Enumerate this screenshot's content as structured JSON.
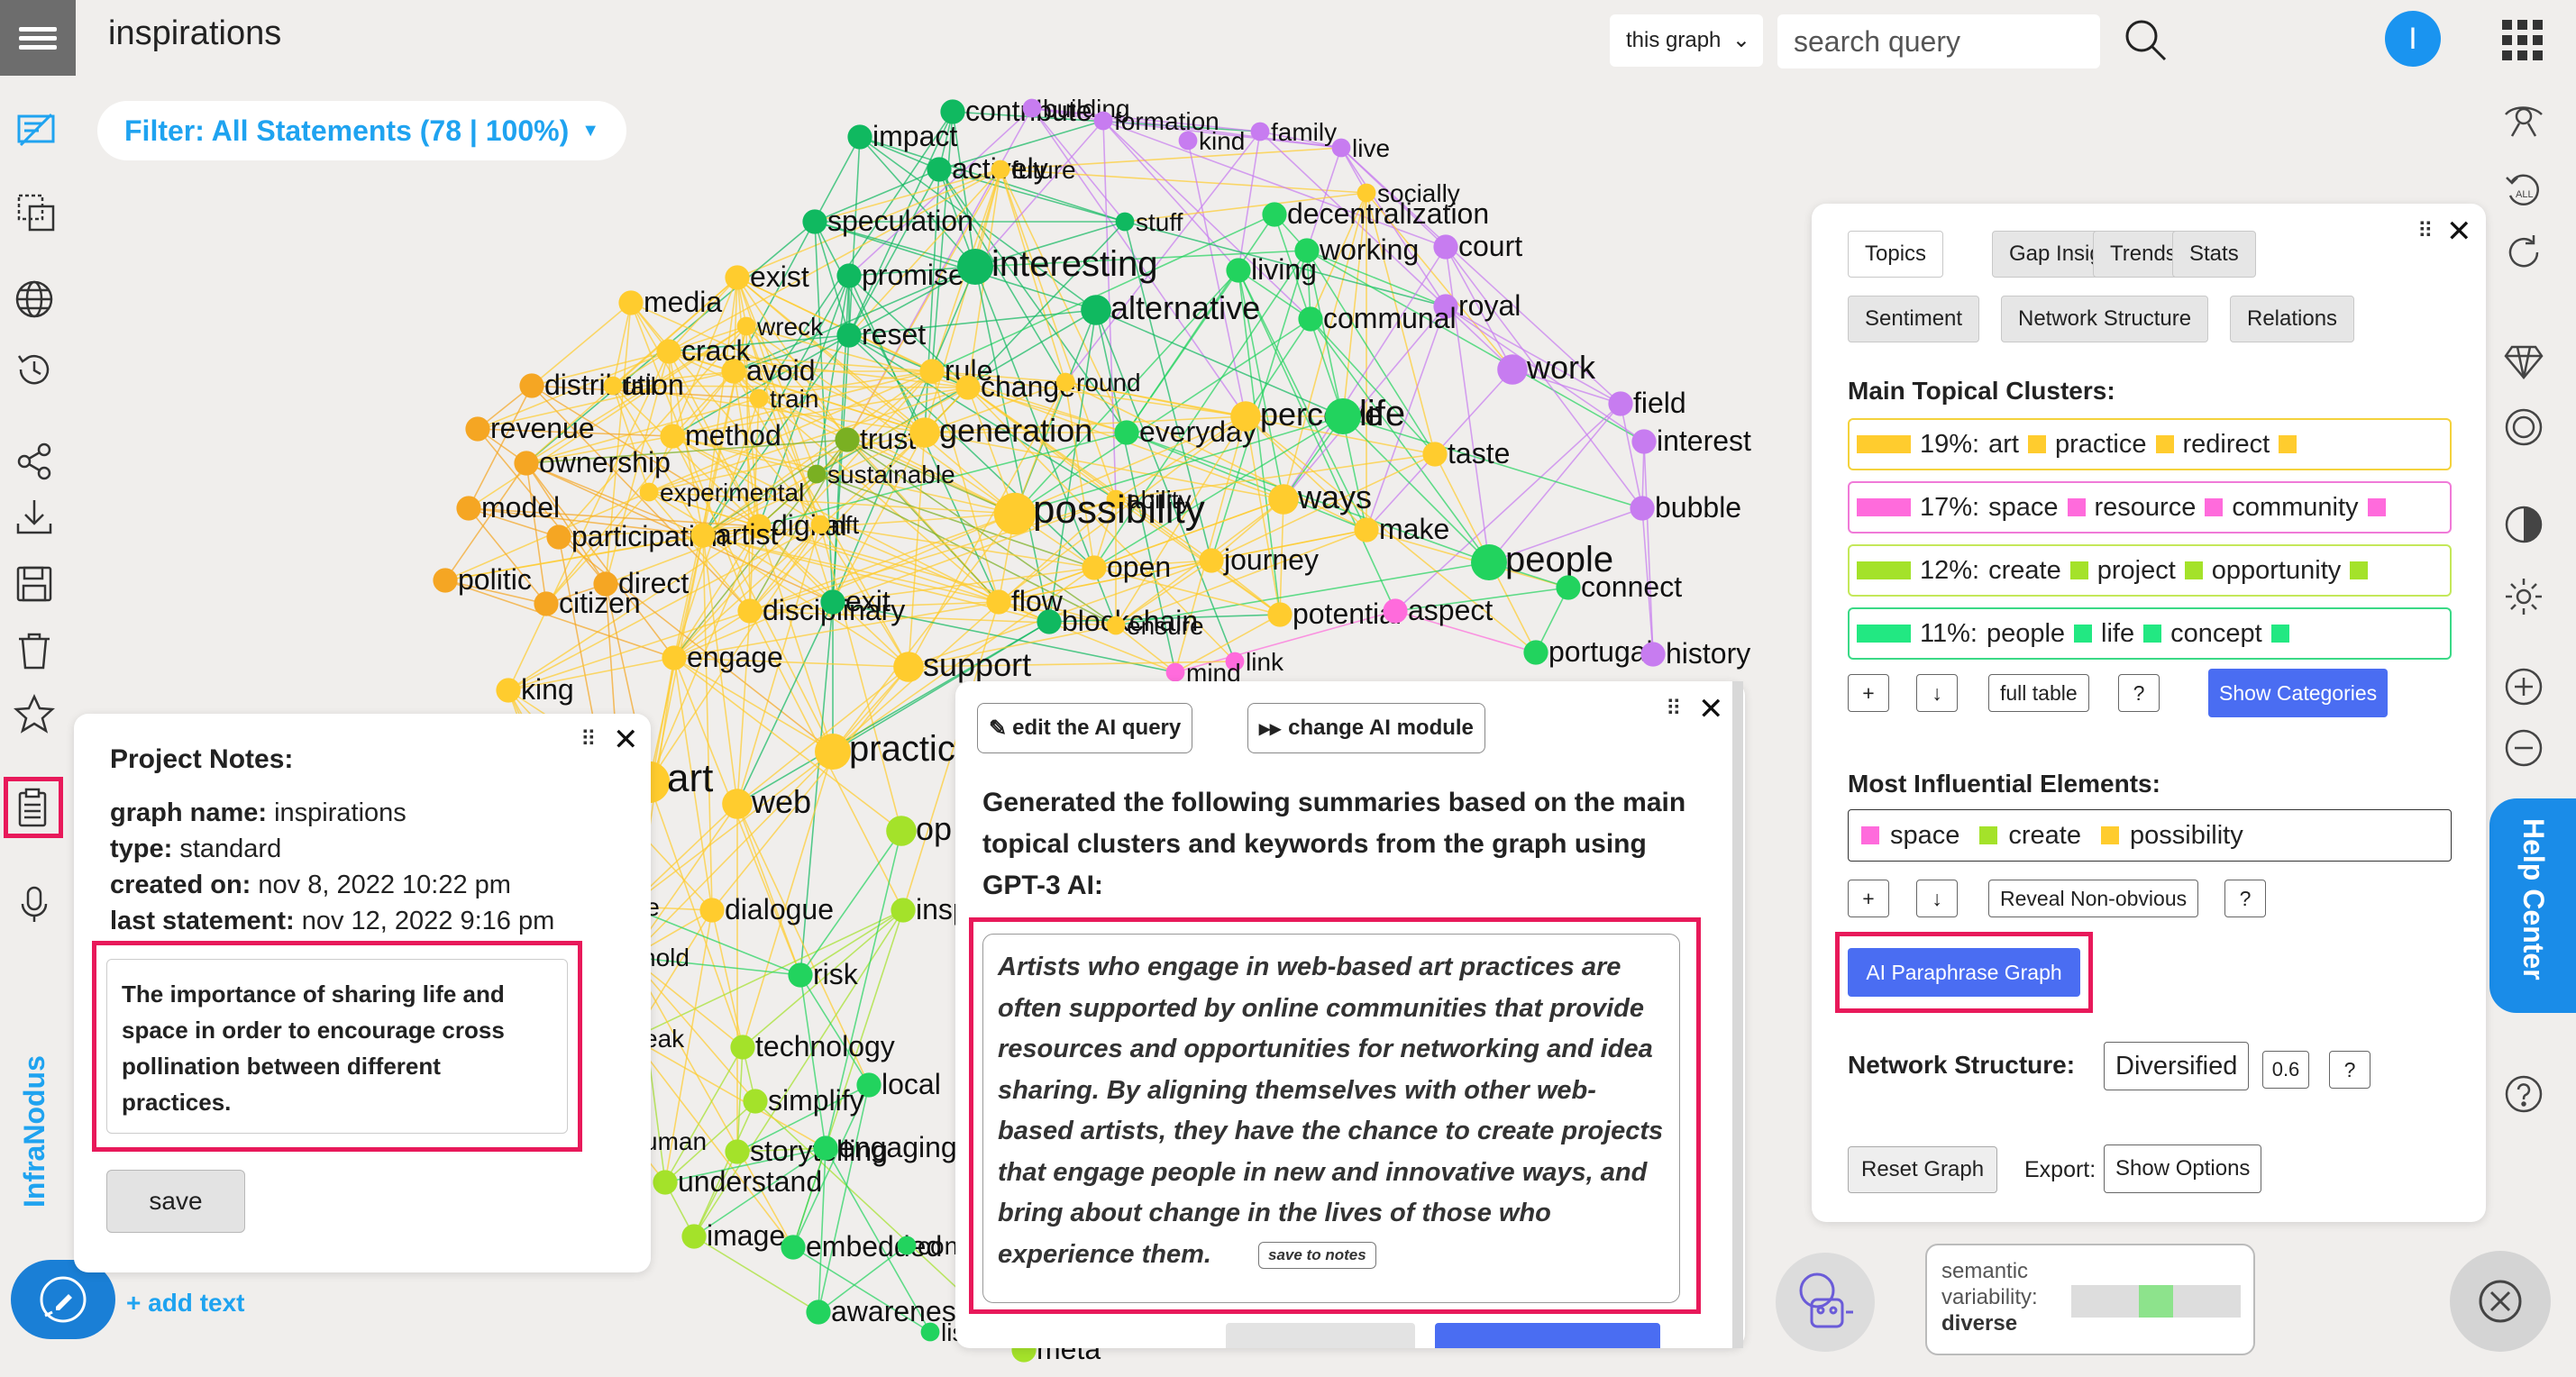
{
  "header": {
    "title": "inspirations",
    "scope": "this graph",
    "search_placeholder": "search query",
    "avatar_letter": "I"
  },
  "filter": {
    "label": "Filter: All Statements (78 | 100%)"
  },
  "brand": "InfraNodus",
  "add_text": "+ add text",
  "colors": {
    "accent": "#1fa3f0",
    "highlight": "#e8195a",
    "yellow": "#ffcc2e",
    "orange": "#f5a623",
    "green": "#22d35e",
    "lime": "#a4e22a",
    "pink": "#ff6bdc",
    "violet": "#c77cf0",
    "blue_btn": "#4a6df2"
  },
  "notes": {
    "title": "Project Notes:",
    "graph_name_label": "graph name:",
    "graph_name": "inspirations",
    "type_label": "type:",
    "type": "standard",
    "created_label": "created on:",
    "created": "nov 8, 2022 10:22 pm",
    "last_label": "last statement:",
    "last": "nov 12, 2022 9:16 pm",
    "text": "The importance of sharing life and space in order to encourage cross pollination between different practices.",
    "save": "save"
  },
  "ai_panel": {
    "edit_query": "edit the AI query",
    "change_module": "change AI module",
    "heading": "Generated the following summaries based on the main topical clusters and keywords from the graph using GPT-3 AI:",
    "summary": "Artists who engage in web-based art practices are often supported by online communities that provide resources and opportunities for networking and idea sharing. By aligning themselves with other web-based artists, they have the chance to create projects that engage people in new and innovative ways, and bring about change in the lives of those who experience them.",
    "save_to_notes": "save to notes"
  },
  "analysis": {
    "tabs_row1": [
      "Topics",
      "Gap Insight",
      "Trends",
      "Stats"
    ],
    "tabs_row2": [
      "Sentiment",
      "Network Structure",
      "Relations"
    ],
    "clusters_heading": "Main Topical Clusters:",
    "clusters": [
      {
        "pct": "19%:",
        "words": [
          "art",
          "practice",
          "redirect"
        ],
        "color": "#ffcc2e",
        "border": "#f4d23c"
      },
      {
        "pct": "17%:",
        "words": [
          "space",
          "resource",
          "community"
        ],
        "color": "#ff6bdc",
        "border": "#f07ad8"
      },
      {
        "pct": "12%:",
        "words": [
          "create",
          "project",
          "opportunity"
        ],
        "color": "#a4e22a",
        "border": "#c4e85a"
      },
      {
        "pct": "11%:",
        "words": [
          "people",
          "life",
          "concept"
        ],
        "color": "#22e882",
        "border": "#3ad986"
      }
    ],
    "cluster_buttons": {
      "plus": "+",
      "download": "↓",
      "full_table": "full table",
      "help": "?",
      "show_categories": "Show Categories"
    },
    "influential_heading": "Most Influential Elements:",
    "influential": [
      {
        "word": "space",
        "color": "#ff6bdc"
      },
      {
        "word": "create",
        "color": "#a4e22a"
      },
      {
        "word": "possibility",
        "color": "#ffcc2e"
      }
    ],
    "influential_buttons": {
      "plus": "+",
      "download": "↓",
      "reveal": "Reveal Non-obvious",
      "help": "?"
    },
    "paraphrase": "AI Paraphrase Graph",
    "structure_label": "Network Structure:",
    "structure_value": "Diversified",
    "structure_score": "0.6",
    "structure_help": "?",
    "reset": "Reset Graph",
    "export_label": "Export:",
    "show_options": "Show Options"
  },
  "help_center": "Help Center",
  "semantic": {
    "line1": "semantic",
    "line2": "variability:",
    "value": "diverse",
    "level": 0.5
  },
  "graph_labels": [
    [
      "contribute",
      "#10b960"
    ],
    [
      "building",
      "#c77cf0"
    ],
    [
      "impact",
      "#10b960"
    ],
    [
      "actively",
      "#10b960"
    ],
    [
      "future",
      "#ffcc2e"
    ],
    [
      "formation",
      "#c77cf0"
    ],
    [
      "kind",
      "#c77cf0"
    ],
    [
      "family",
      "#c77cf0"
    ],
    [
      "live",
      "#c77cf0"
    ],
    [
      "socially",
      "#ffcc2e"
    ],
    [
      "speculation",
      "#10b960"
    ],
    [
      "stuff",
      "#10b960"
    ],
    [
      "decentralization",
      "#22d35e"
    ],
    [
      "working",
      "#22d35e"
    ],
    [
      "court",
      "#c77cf0"
    ],
    [
      "exist",
      "#ffcc2e"
    ],
    [
      "promise",
      "#10b960"
    ],
    [
      "interesting",
      "#10b960"
    ],
    [
      "living",
      "#22d35e"
    ],
    [
      "royal",
      "#c77cf0"
    ],
    [
      "media",
      "#ffcc2e"
    ],
    [
      "wreck",
      "#ffcc2e"
    ],
    [
      "reset",
      "#10b960"
    ],
    [
      "alternative",
      "#10b960"
    ],
    [
      "communal",
      "#22d35e"
    ],
    [
      "crack",
      "#ffcc2e"
    ],
    [
      "work",
      "#c77cf0"
    ],
    [
      "distribution",
      "#f5a623"
    ],
    [
      "fall",
      "#ffcc2e"
    ],
    [
      "avoid",
      "#ffcc2e"
    ],
    [
      "rule",
      "#ffcc2e"
    ],
    [
      "change",
      "#ffcc2e"
    ],
    [
      "round",
      "#ffcc2e"
    ],
    [
      "train",
      "#ffcc2e"
    ],
    [
      "field",
      "#c77cf0"
    ],
    [
      "revenue",
      "#f5a623"
    ],
    [
      "method",
      "#ffcc2e"
    ],
    [
      "trust",
      "#7ab022"
    ],
    [
      "generation",
      "#ffcc2e"
    ],
    [
      "everyday",
      "#22d35e"
    ],
    [
      "perceive",
      "#ffcc2e"
    ],
    [
      "life",
      "#22d35e"
    ],
    [
      "interest",
      "#c77cf0"
    ],
    [
      "ownership",
      "#f5a623"
    ],
    [
      "sustainable",
      "#7ab022"
    ],
    [
      "taste",
      "#ffcc2e"
    ],
    [
      "experimental",
      "#ffcc2e"
    ],
    [
      "ability",
      "#ffcc2e"
    ],
    [
      "ways",
      "#ffcc2e"
    ],
    [
      "model",
      "#f5a623"
    ],
    [
      "digital",
      "#ffcc2e"
    ],
    [
      "nft",
      "#ffcc2e"
    ],
    [
      "possibility",
      "#ffcc2e"
    ],
    [
      "bubble",
      "#c77cf0"
    ],
    [
      "participation",
      "#f5a623"
    ],
    [
      "artist",
      "#ffcc2e"
    ],
    [
      "make",
      "#ffcc2e"
    ],
    [
      "people",
      "#22d35e"
    ],
    [
      "open",
      "#ffcc2e"
    ],
    [
      "journey",
      "#ffcc2e"
    ],
    [
      "politic",
      "#f5a623"
    ],
    [
      "direct",
      "#f5a623"
    ],
    [
      "citizen",
      "#f5a623"
    ],
    [
      "connect",
      "#22d35e"
    ],
    [
      "disciplinary",
      "#ffcc2e"
    ],
    [
      "exit",
      "#10b960"
    ],
    [
      "flow",
      "#ffcc2e"
    ],
    [
      "blockchain",
      "#10b960"
    ],
    [
      "potential",
      "#ffcc2e"
    ],
    [
      "aspect",
      "#ff6bdc"
    ],
    [
      "ensure",
      "#ffcc2e"
    ],
    [
      "portugal",
      "#22d35e"
    ],
    [
      "history",
      "#c77cf0"
    ],
    [
      "engage",
      "#ffcc2e"
    ],
    [
      "support",
      "#ffcc2e"
    ],
    [
      "link",
      "#ff6bdc"
    ],
    [
      "mind",
      "#ff6bdc"
    ],
    [
      "king",
      "#ffcc2e"
    ],
    [
      "art",
      "#ffcc2e"
    ],
    [
      "practice",
      "#ffcc2e"
    ],
    [
      "web",
      "#ffcc2e"
    ],
    [
      "dialogue",
      "#ffcc2e"
    ],
    [
      "inspire",
      "#a4e22a"
    ],
    [
      "risk",
      "#22d35e"
    ],
    [
      "hold",
      "#ffcc2e"
    ],
    [
      "technology",
      "#a4e22a"
    ],
    [
      "local",
      "#22d35e"
    ],
    [
      "simplify",
      "#a4e22a"
    ],
    [
      "eak",
      "#ffcc2e"
    ],
    [
      "uman",
      "#ffcc2e"
    ],
    [
      "storytelling",
      "#a4e22a"
    ],
    [
      "engaging",
      "#22d35e"
    ],
    [
      "understand",
      "#a4e22a"
    ],
    [
      "image",
      "#a4e22a"
    ],
    [
      "embedded",
      "#22d35e"
    ],
    [
      "cont",
      "#22d35e"
    ],
    [
      "awareness",
      "#22d35e"
    ],
    [
      "lis",
      "#22d35e"
    ],
    [
      "meta",
      "#a4e22a"
    ],
    [
      "ie",
      "#ffcc2e"
    ],
    [
      "op",
      "#a4e22a"
    ]
  ]
}
